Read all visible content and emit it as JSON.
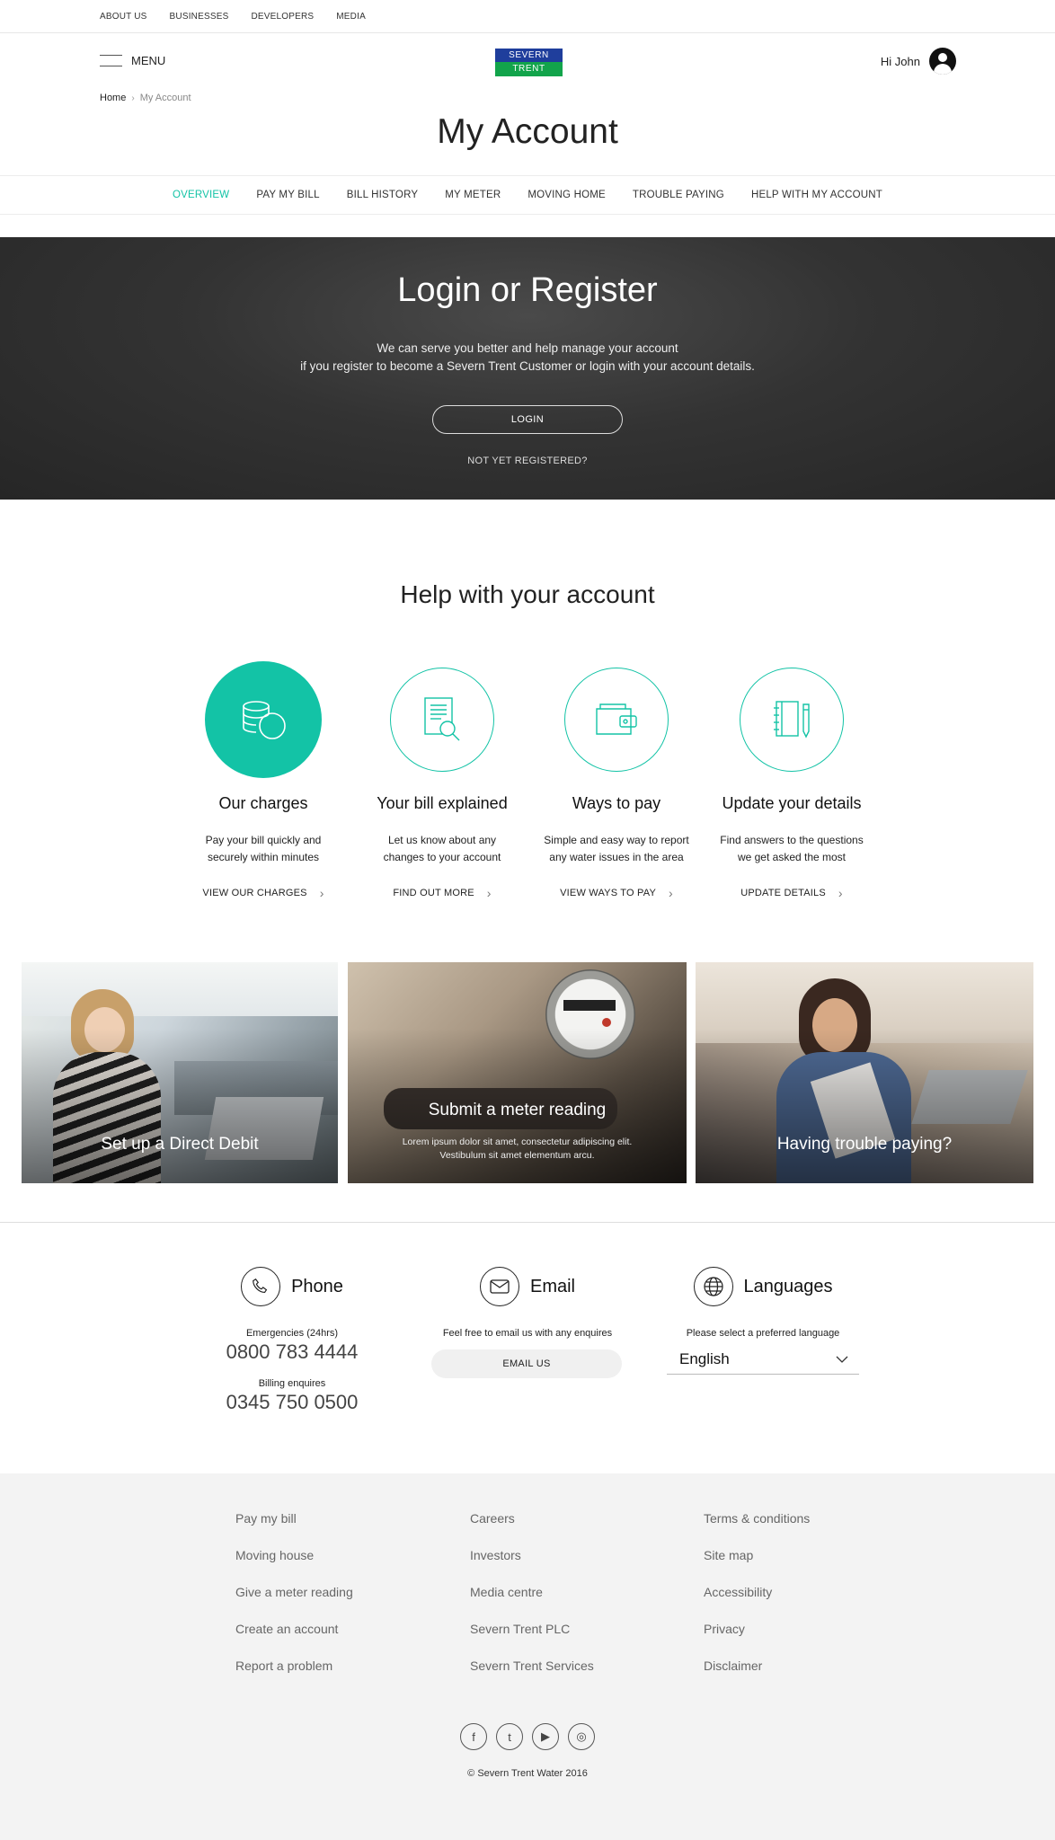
{
  "topnav": [
    "ABOUT US",
    "BUSINESSES",
    "DEVELOPERS",
    "MEDIA"
  ],
  "header": {
    "menu_label": "MENU",
    "logo_top": "SEVERN",
    "logo_bottom": "TRENT",
    "greeting": "Hi John"
  },
  "breadcrumb": {
    "home": "Home",
    "separator": "›",
    "current": "My Account"
  },
  "page_title": "My Account",
  "tabs": [
    "OVERVIEW",
    "PAY MY BILL",
    "BILL HISTORY",
    "MY METER",
    "MOVING HOME",
    "TROUBLE PAYING",
    "HELP WITH MY ACCOUNT"
  ],
  "active_tab": "OVERVIEW",
  "hero": {
    "title": "Login or Register",
    "line1": "We can serve you better and help manage your account",
    "line2": "if you register to become a Severn Trent Customer or login with your account details.",
    "login_label": "LOGIN",
    "register_label": "NOT YET REGISTERED?"
  },
  "help": {
    "title": "Help with your account",
    "cards": [
      {
        "icon": "coins-icon",
        "title": "Our charges",
        "line1": "Pay your bill quickly and",
        "line2": "securely within minutes",
        "cta": "VIEW OUR CHARGES"
      },
      {
        "icon": "bill-search-icon",
        "title": "Your bill explained",
        "line1": "Let us know about any",
        "line2": "changes to your account",
        "cta": "FIND OUT MORE"
      },
      {
        "icon": "wallet-icon",
        "title": "Ways to pay",
        "line1": "Simple and easy way to report",
        "line2": "any water issues in the area",
        "cta": "VIEW WAYS TO PAY"
      },
      {
        "icon": "notebook-icon",
        "title": "Update your details",
        "line1": "Find answers to the questions",
        "line2": "we get asked the most",
        "cta": "UPDATE DETAILS"
      }
    ]
  },
  "tiles": [
    {
      "title": "Set up a Direct Debit"
    },
    {
      "title": "Submit a meter reading",
      "line1": "Lorem ipsum dolor sit amet, consectetur adipiscing elit.",
      "line2": "Vestibulum sit amet elementum arcu."
    },
    {
      "title": "Having trouble paying?"
    }
  ],
  "contact": {
    "phone": {
      "label": "Phone",
      "emergency_label": "Emergencies (24hrs)",
      "emergency_number": "0800 783 4444",
      "billing_label": "Billing enquires",
      "billing_number": "0345 750 0500"
    },
    "email": {
      "label": "Email",
      "text": "Feel free to email us with any enquires",
      "button": "EMAIL US"
    },
    "languages": {
      "label": "Languages",
      "text": "Please select a preferred language",
      "selected": "English"
    }
  },
  "footer": {
    "col1": [
      "Pay my bill",
      "Moving house",
      "Give a meter reading",
      "Create an account",
      "Report a problem"
    ],
    "col2": [
      "Careers",
      "Investors",
      "Media centre",
      "Severn Trent PLC",
      "Severn Trent Services"
    ],
    "col3": [
      "Terms & conditions",
      "Site map",
      "Accessibility",
      "Privacy",
      "Disclaimer"
    ],
    "social": [
      {
        "icon": "facebook-icon",
        "glyph": "f"
      },
      {
        "icon": "twitter-icon",
        "glyph": "t"
      },
      {
        "icon": "youtube-icon",
        "glyph": "▶"
      },
      {
        "icon": "instagram-icon",
        "glyph": "◎"
      }
    ],
    "copyright": "© Severn Trent Water 2016"
  },
  "colors": {
    "accent": "#13c3a6",
    "hero_bg": "#2f2f2f",
    "footer_bg": "#f3f3f3"
  }
}
